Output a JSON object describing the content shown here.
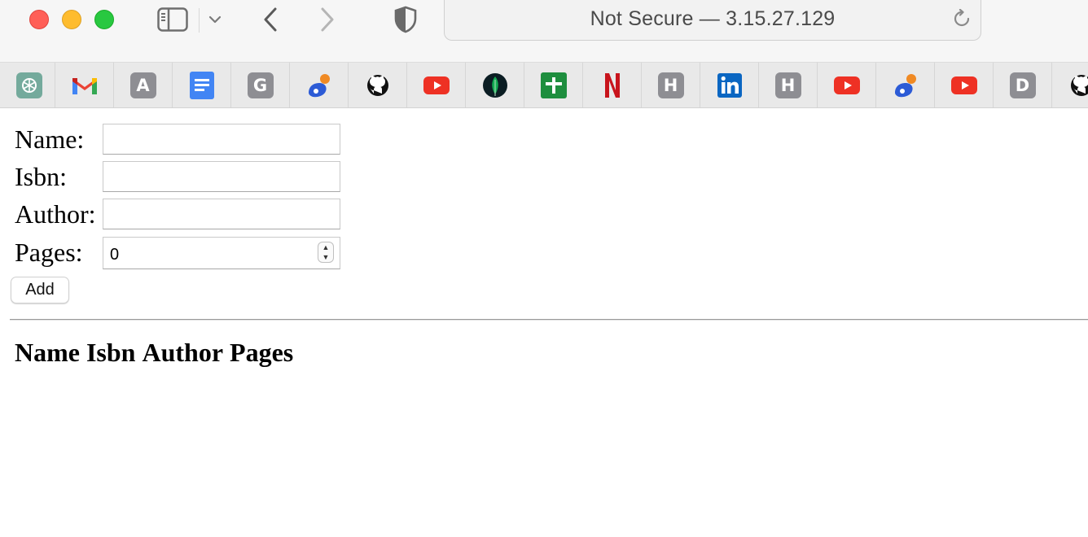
{
  "browser": {
    "address": "Not Secure — 3.15.27.129"
  },
  "favorites": [
    {
      "icon": "chatgpt-icon",
      "color": "#74aa9c"
    },
    {
      "icon": "gmail-icon",
      "color": "#ea4335"
    },
    {
      "icon": "letter-a-icon",
      "letter": "A",
      "color": "#8e8e93"
    },
    {
      "icon": "google-docs-icon",
      "color": "#4285f4"
    },
    {
      "icon": "letter-g-icon",
      "letter": "G",
      "color": "#8e8e93"
    },
    {
      "icon": "dot-orange-blue-icon",
      "color": "#2c5bd6"
    },
    {
      "icon": "github-icon",
      "color": "#111111"
    },
    {
      "icon": "youtube-icon",
      "color": "#ff0000"
    },
    {
      "icon": "mongodb-leaf-icon",
      "color": "#13aa52"
    },
    {
      "icon": "google-sheets-plus-icon",
      "color": "#1e8e3e"
    },
    {
      "icon": "netflix-icon",
      "color": "#e50914"
    },
    {
      "icon": "letter-h-icon",
      "letter": "H",
      "color": "#8e8e93"
    },
    {
      "icon": "linkedin-icon",
      "color": "#0a66c2"
    },
    {
      "icon": "letter-h-icon",
      "letter": "H",
      "color": "#8e8e93"
    },
    {
      "icon": "youtube-icon",
      "color": "#ff0000"
    },
    {
      "icon": "dot-orange-blue-icon",
      "color": "#2c5bd6"
    },
    {
      "icon": "youtube-icon",
      "color": "#ff0000"
    },
    {
      "icon": "letter-d-icon",
      "letter": "D",
      "color": "#8e8e93"
    },
    {
      "icon": "github-icon",
      "color": "#111111"
    }
  ],
  "form": {
    "name_label": "Name:",
    "isbn_label": "Isbn:",
    "author_label": "Author:",
    "pages_label": "Pages:",
    "name_value": "",
    "isbn_value": "",
    "author_value": "",
    "pages_value": "0",
    "add_label": "Add"
  },
  "table": {
    "headers": [
      "Name",
      "Isbn",
      "Author",
      "Pages"
    ]
  }
}
